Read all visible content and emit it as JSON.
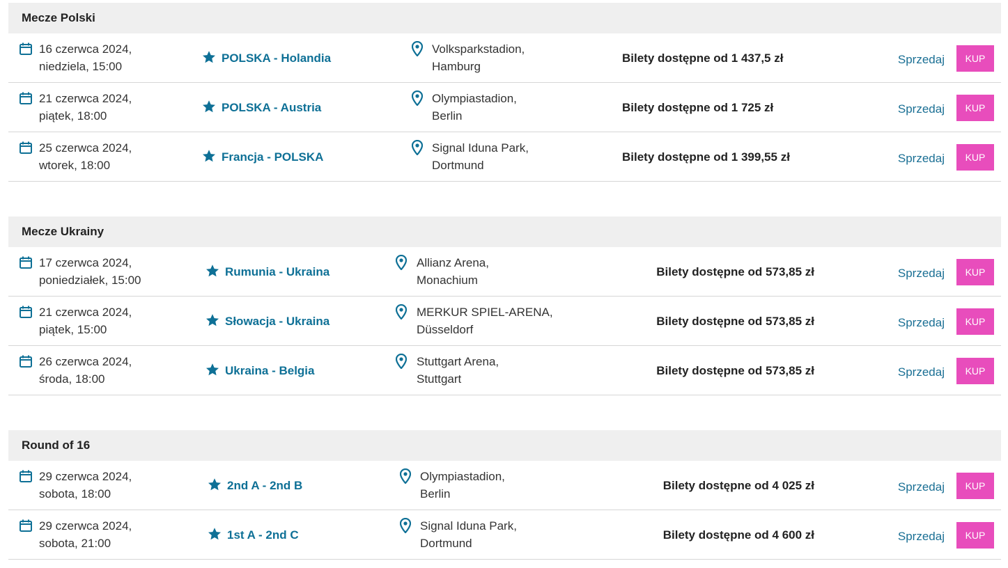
{
  "colors": {
    "accent_blue": "#0e7096",
    "buy_pink": "#e84dbc",
    "header_bg": "#efefef"
  },
  "icons": {
    "date": "calendar-icon",
    "match": "star-icon",
    "venue": "map-pin-icon"
  },
  "sections": [
    {
      "title": "Mecze Polski",
      "rows": [
        {
          "date_line1": "16 czerwca 2024,",
          "date_line2": "niedziela, 15:00",
          "match": "POLSKA - Holandia",
          "venue_line1": "Volksparkstadion,",
          "venue_line2": "Hamburg",
          "price": "Bilety dostępne od 1 437,5 zł",
          "sell": "Sprzedaj",
          "buy": "KUP"
        },
        {
          "date_line1": "21 czerwca 2024,",
          "date_line2": "piątek, 18:00",
          "match": "POLSKA - Austria",
          "venue_line1": "Olympiastadion,",
          "venue_line2": "Berlin",
          "price": "Bilety dostępne od 1 725 zł",
          "sell": "Sprzedaj",
          "buy": "KUP"
        },
        {
          "date_line1": "25 czerwca 2024,",
          "date_line2": "wtorek, 18:00",
          "match": "Francja - POLSKA",
          "venue_line1": "Signal Iduna Park,",
          "venue_line2": "Dortmund",
          "price": "Bilety dostępne od 1 399,55 zł",
          "sell": "Sprzedaj",
          "buy": "KUP"
        }
      ]
    },
    {
      "title": "Mecze Ukrainy",
      "rows": [
        {
          "date_line1": "17 czerwca 2024,",
          "date_line2": "poniedziałek, 15:00",
          "match": "Rumunia - Ukraina",
          "venue_line1": "Allianz Arena,",
          "venue_line2": "Monachium",
          "price": "Bilety dostępne od 573,85 zł",
          "sell": "Sprzedaj",
          "buy": "KUP"
        },
        {
          "date_line1": "21 czerwca 2024,",
          "date_line2": "piątek, 15:00",
          "match": "Słowacja - Ukraina",
          "venue_line1": "MERKUR SPIEL-ARENA,",
          "venue_line2": "Düsseldorf",
          "price": "Bilety dostępne od 573,85 zł",
          "sell": "Sprzedaj",
          "buy": "KUP"
        },
        {
          "date_line1": "26 czerwca 2024,",
          "date_line2": "środa, 18:00",
          "match": "Ukraina - Belgia",
          "venue_line1": "Stuttgart Arena,",
          "venue_line2": "Stuttgart",
          "price": "Bilety dostępne od 573,85 zł",
          "sell": "Sprzedaj",
          "buy": "KUP"
        }
      ]
    },
    {
      "title": "Round of 16",
      "rows": [
        {
          "date_line1": "29 czerwca 2024,",
          "date_line2": "sobota, 18:00",
          "match": "2nd A - 2nd B",
          "venue_line1": "Olympiastadion,",
          "venue_line2": "Berlin",
          "price": "Bilety dostępne od 4 025 zł",
          "sell": "Sprzedaj",
          "buy": "KUP"
        },
        {
          "date_line1": "29 czerwca 2024,",
          "date_line2": "sobota, 21:00",
          "match": "1st A - 2nd C",
          "venue_line1": "Signal Iduna Park,",
          "venue_line2": "Dortmund",
          "price": "Bilety dostępne od 4 600 zł",
          "sell": "Sprzedaj",
          "buy": "KUP"
        }
      ]
    }
  ]
}
